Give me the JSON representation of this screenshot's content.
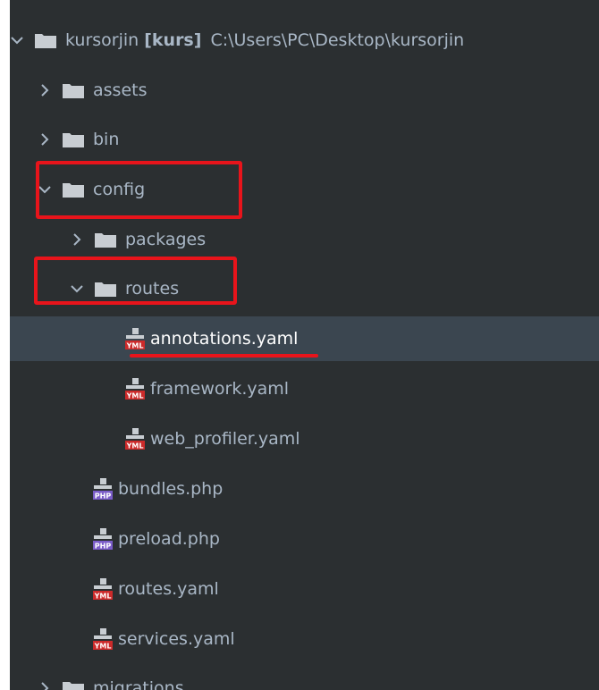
{
  "tree": {
    "root": {
      "name": "kursorjin",
      "module": "[kurs]",
      "path": "C:\\Users\\PC\\Desktop\\kursorjin"
    },
    "items": [
      {
        "label": "assets"
      },
      {
        "label": "bin"
      },
      {
        "label": "config"
      },
      {
        "label": "packages"
      },
      {
        "label": "routes"
      },
      {
        "label": "annotations.yaml"
      },
      {
        "label": "framework.yaml"
      },
      {
        "label": "web_profiler.yaml"
      },
      {
        "label": "bundles.php"
      },
      {
        "label": "preload.php"
      },
      {
        "label": "routes.yaml"
      },
      {
        "label": "services.yaml"
      },
      {
        "label": "migrations"
      }
    ]
  },
  "icons": {
    "yaml_badge": "YML",
    "php_badge": "PHP"
  },
  "colors": {
    "panel_bg": "#2b2f31",
    "selected_row": "#3b4650",
    "text": "#a9b7c6",
    "folder": "#c8cdd2",
    "yaml_badge": "#cc2a2a",
    "php_badge": "#7a5cc8",
    "annotation_red": "#e8141b"
  }
}
